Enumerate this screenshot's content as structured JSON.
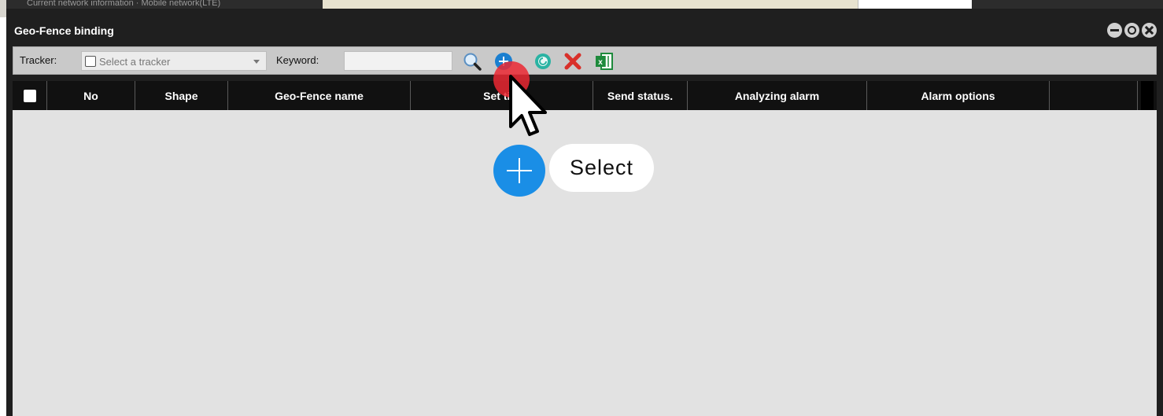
{
  "background": {
    "tab_text": "Current network information  ·  Mobile network(LTE)"
  },
  "window": {
    "title": "Geo-Fence binding"
  },
  "toolbar": {
    "tracker_label": "Tracker:",
    "tracker_placeholder": "Select a tracker",
    "keyword_label": "Keyword:",
    "keyword_value": "",
    "icons": [
      "search-icon",
      "add-icon",
      "refresh-icon",
      "delete-icon",
      "excel-export-icon"
    ]
  },
  "table": {
    "columns": [
      "No",
      "Shape",
      "Geo-Fence name",
      "Set tim",
      "Send status.",
      "Analyzing alarm",
      "Alarm options",
      ""
    ],
    "rows": []
  },
  "overlay": {
    "action_label": "Select"
  },
  "colors": {
    "titlebar": "#1f1f1f",
    "toolbar": "#c9c9c9",
    "header": "#111111",
    "grid": "#e2e2e2",
    "accent_blue": "#1a8ee6",
    "click_red": "#eb2832",
    "delete_red": "#d9302a",
    "excel_green": "#1e8a3c"
  }
}
